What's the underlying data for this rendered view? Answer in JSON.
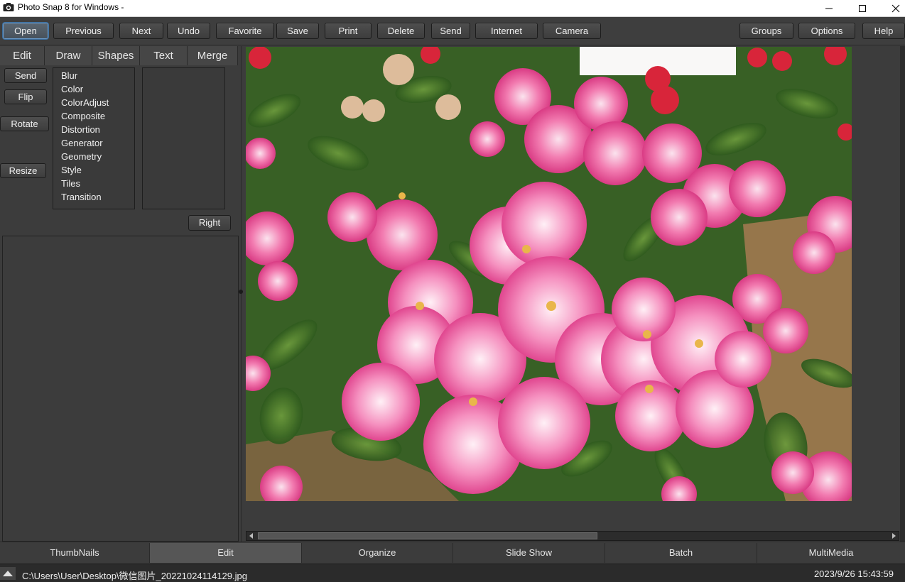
{
  "window": {
    "title": "Photo Snap 8 for Windows -",
    "app_icon": "camera-icon",
    "controls": [
      "minimize-icon",
      "maximize-icon",
      "close-icon"
    ]
  },
  "toolbar": {
    "buttons": [
      "Open",
      "Previous",
      "Next",
      "Undo",
      "Favorite",
      "Save",
      "Print",
      "Delete",
      "Send",
      "Internet",
      "Camera"
    ],
    "active": "Open",
    "right_buttons": [
      "Groups",
      "Options",
      "Help"
    ]
  },
  "edit_panel": {
    "tabs": [
      "Edit",
      "Draw",
      "Shapes",
      "Text",
      "Merge"
    ],
    "side_buttons": [
      "Send",
      "Flip",
      "Rotate",
      "Resize"
    ],
    "effects": [
      "Blur",
      "Color",
      "ColorAdjust",
      "Composite",
      "Distortion",
      "Generator",
      "Geometry",
      "Style",
      "Tiles",
      "Transition"
    ],
    "right_button": "Right"
  },
  "viewer": {
    "image": "pink roses photo",
    "colors": {
      "background": "#3c3c3c",
      "scroll": "#2c2c2c"
    }
  },
  "mode_tabs": {
    "items": [
      "ThumbNails",
      "Edit",
      "Organize",
      "Slide Show",
      "Batch",
      "MultiMedia"
    ],
    "active": "Edit"
  },
  "status": {
    "path": "C:\\Users\\User\\Desktop\\微信图片_20221024114129.jpg",
    "datetime": "2023/9/26 15:43:59"
  }
}
